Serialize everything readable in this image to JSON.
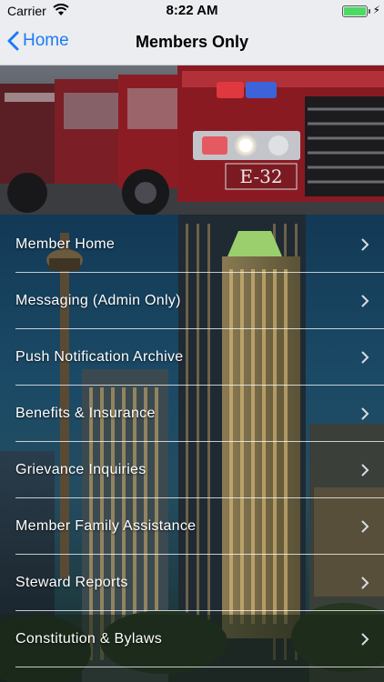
{
  "status_bar": {
    "carrier": "Carrier",
    "time": "8:22 AM",
    "wifi_icon": "wifi-icon",
    "battery_icon": "battery-icon",
    "battery_color": "#4cd964"
  },
  "nav": {
    "back_label": "Home",
    "title": "Members Only",
    "accent": "#1a7cf5"
  },
  "hero": {
    "truck_label": "E-32"
  },
  "menu": {
    "items": [
      {
        "label": "Member Home"
      },
      {
        "label": "Messaging (Admin Only)"
      },
      {
        "label": "Push Notification Archive"
      },
      {
        "label": "Benefits & Insurance"
      },
      {
        "label": "Grievance Inquiries"
      },
      {
        "label": "Member Family Assistance"
      },
      {
        "label": "Steward Reports"
      },
      {
        "label": "Constitution & Bylaws"
      }
    ]
  }
}
